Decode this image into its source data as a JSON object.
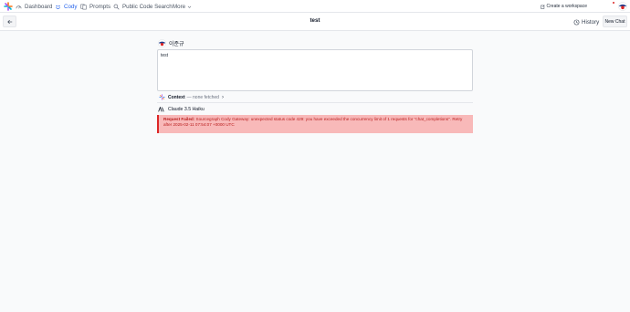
{
  "nav": {
    "items": [
      {
        "label": "Dashboard",
        "icon": "dashboard-icon"
      },
      {
        "label": "Cody",
        "icon": "cody-icon",
        "active": true
      },
      {
        "label": "Prompts",
        "icon": "prompts-icon"
      },
      {
        "label": "Public Code Search",
        "icon": "search-icon"
      },
      {
        "label": "More",
        "icon": "chevron-down-icon"
      }
    ],
    "create_workspace": "Create a workspace",
    "accent": "#2563eb"
  },
  "chat": {
    "title": "test",
    "history_label": "History",
    "new_chat_label": "New Chat"
  },
  "message": {
    "user_name": "이준규",
    "text": "test"
  },
  "context": {
    "label": "Context",
    "detail": "— none fetched"
  },
  "model": {
    "name": "Claude 3.5 Haiku"
  },
  "error": {
    "label": "Request Failed:",
    "message": "Sourcegraph Cody Gateway: unexpected status code 429: you have exceeded the concurrency limit of 1 requests for \"chat_completions\". Retry after 2025-02-11 07:54:07 +0000 UTC",
    "color": "#dc2626",
    "background": "#f8b9b9"
  }
}
